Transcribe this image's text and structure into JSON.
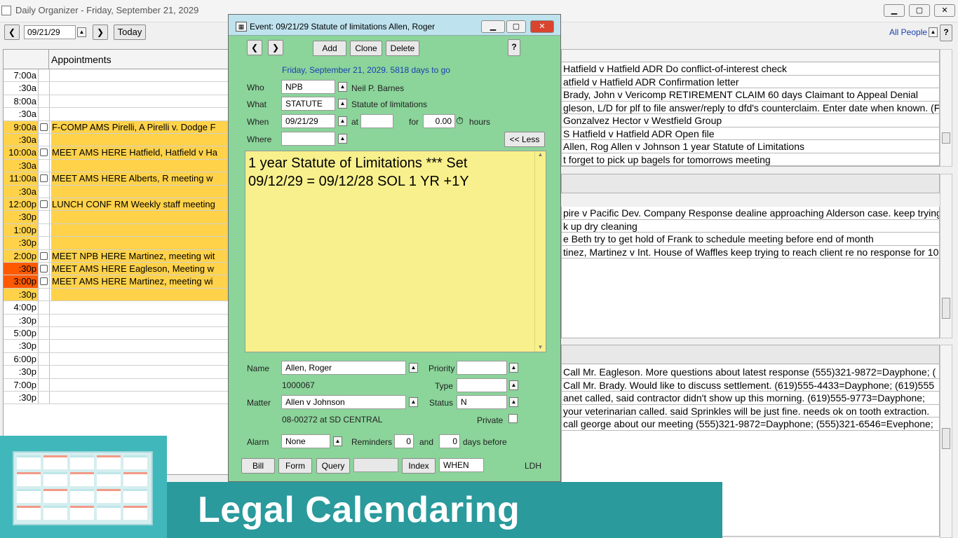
{
  "app": {
    "title": "Daily Organizer - Friday, September 21, 2029"
  },
  "toolbar": {
    "date": "09/21/29",
    "today": "Today",
    "all_people": "All People",
    "help": "?"
  },
  "appointments": {
    "header": "Appointments",
    "rows": [
      {
        "time": "7:00a",
        "text": ""
      },
      {
        "time": ":30a",
        "text": ""
      },
      {
        "time": "8:00a",
        "text": ""
      },
      {
        "time": ":30a",
        "text": ""
      },
      {
        "time": "9:00a",
        "text": "F-COMP AMS Pirelli, A Pirelli v. Dodge F"
      },
      {
        "time": ":30a",
        "text": ""
      },
      {
        "time": "10:00a",
        "text": "MEET AMS HERE Hatfield, Hatfield v Ha"
      },
      {
        "time": ":30a",
        "text": ""
      },
      {
        "time": "11:00a",
        "text": "MEET AMS HERE Alberts, R meeting w"
      },
      {
        "time": ":30a",
        "text": ""
      },
      {
        "time": "12:00p",
        "text": "LUNCH CONF RM Weekly staff meeting"
      },
      {
        "time": ":30p",
        "text": ""
      },
      {
        "time": "1:00p",
        "text": ""
      },
      {
        "time": ":30p",
        "text": ""
      },
      {
        "time": "2:00p",
        "text": "MEET NPB HERE Martinez, meeting wit"
      },
      {
        "time": ":30p",
        "text": "MEET AMS HERE Eagleson, Meeting w"
      },
      {
        "time": "3:00p",
        "text": "MEET AMS HERE Martinez, meeting wi"
      },
      {
        "time": ":30p",
        "text": ""
      },
      {
        "time": "4:00p",
        "text": ""
      },
      {
        "time": ":30p",
        "text": ""
      },
      {
        "time": "5:00p",
        "text": ""
      },
      {
        "time": ":30p",
        "text": ""
      },
      {
        "time": "6:00p",
        "text": ""
      },
      {
        "time": ":30p",
        "text": ""
      },
      {
        "time": "7:00p",
        "text": ""
      },
      {
        "time": ":30p",
        "text": ""
      }
    ]
  },
  "right_panel_1": [
    "Hatfield v Hatfield ADR Do conflict-of-interest check",
    "atfield v Hatfield ADR Confirmation letter",
    "Brady, John v Vericomp RETIREMENT CLAIM 60 days Claimant to Appeal Denial",
    "gleson, L/D for plf to file answer/reply to dfd's counterclaim. Enter date when known. (F",
    "Gonzalvez Hector v Westfield Group",
    "S Hatfield v Hatfield ADR Open file",
    "Allen, Rog Allen v Johnson 1 year Statute of Limitations",
    "t forget to pick up bagels for tomorrows meeting"
  ],
  "right_panel_2": [
    "pire v Pacific Dev. Company Response dealine approaching Alderson case. keep trying",
    "k up dry cleaning",
    "e Beth try to get hold of Frank to schedule meeting before end of month",
    "tinez, Martinez v Int. House of Waffles keep trying to reach client re no response for 10"
  ],
  "right_panel_3": [
    " Call Mr. Eagleson.  More questions about latest response (555)321-9872=Dayphone; (",
    " Call Mr. Brady.  Would like to discuss settlement. (619)555-4433=Dayphone; (619)555",
    "anet called, said contractor didn't show up this morning. (619)555-9773=Dayphone;",
    " your veterinarian called. said Sprinkles will be just fine.  needs ok on tooth extraction.",
    "call george about our meeting (555)321-9872=Dayphone; (555)321-6546=Evephone;"
  ],
  "dialog": {
    "title": "Event: 09/21/29 Statute of limitations Allen, Roger",
    "add": "Add",
    "clone": "Clone",
    "delete": "Delete",
    "help": "?",
    "subtitle": "Friday, September 21, 2029.  5818 days to go",
    "who_label": "Who",
    "who": "NPB",
    "who_name": "Neil P. Barnes",
    "what_label": "What",
    "what": "STATUTE",
    "what_desc": "Statute of limitations",
    "when_label": "When",
    "when": "09/21/29",
    "at_label": "at",
    "at": "",
    "for_label": "for",
    "hours": "0.00",
    "hours_label": "hours",
    "where_label": "Where",
    "where": "",
    "less": "<< Less",
    "notes": "1 year Statute of Limitations *** Set 09/12/29 = 09/12/28 SOL 1 YR +1Y",
    "name_label": "Name",
    "name": "Allen, Roger",
    "name_id": "1000067",
    "priority_label": "Priority",
    "priority": "",
    "type_label": "Type",
    "type": "",
    "matter_label": "Matter",
    "matter": "Allen v Johnson",
    "matter_id": "08-00272 at SD CENTRAL",
    "status_label": "Status",
    "status": "N",
    "private_label": "Private",
    "alarm_label": "Alarm",
    "alarm": "None",
    "reminders_label": "Reminders",
    "reminders": "0",
    "and_label": "and",
    "days": "0",
    "days_before": "days before",
    "bill": "Bill",
    "form": "Form",
    "query": "Query",
    "index": "Index",
    "index_value": "WHEN",
    "user": "LDH"
  },
  "banner": {
    "text": "Legal Calendaring"
  }
}
